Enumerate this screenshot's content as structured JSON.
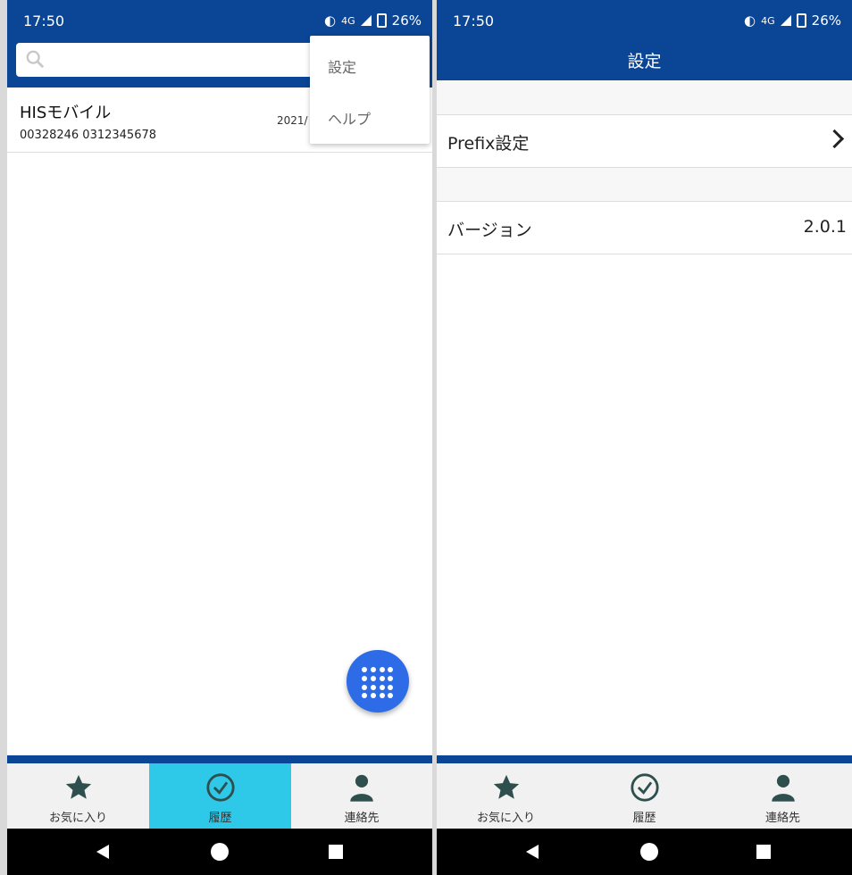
{
  "left_screen": {
    "status": {
      "time": "17:50",
      "network": "4G",
      "battery": "26%"
    },
    "search": {
      "placeholder": ""
    },
    "history_item": {
      "name": "HISモバイル",
      "number": "00328246 0312345678",
      "date": "2021/"
    },
    "menu": {
      "items": [
        "設定",
        "ヘルプ"
      ]
    },
    "tabs": [
      {
        "label": "お気に入り",
        "icon": "star-icon"
      },
      {
        "label": "履歴",
        "icon": "clock-icon",
        "active": true
      },
      {
        "label": "連絡先",
        "icon": "person-icon"
      }
    ],
    "colors": {
      "primary": "#0b4596",
      "active_tab": "#2ec9e8",
      "fab": "#2d6ce6"
    }
  },
  "right_screen": {
    "status": {
      "time": "17:50",
      "network": "4G",
      "battery": "26%"
    },
    "title": "設定",
    "prefix_row": {
      "label": "Prefix設定"
    },
    "version_row": {
      "label": "バージョン",
      "value": "2.0.1"
    },
    "tabs": [
      {
        "label": "お気に入り",
        "icon": "star-icon"
      },
      {
        "label": "履歴",
        "icon": "clock-icon"
      },
      {
        "label": "連絡先",
        "icon": "person-icon"
      }
    ]
  }
}
